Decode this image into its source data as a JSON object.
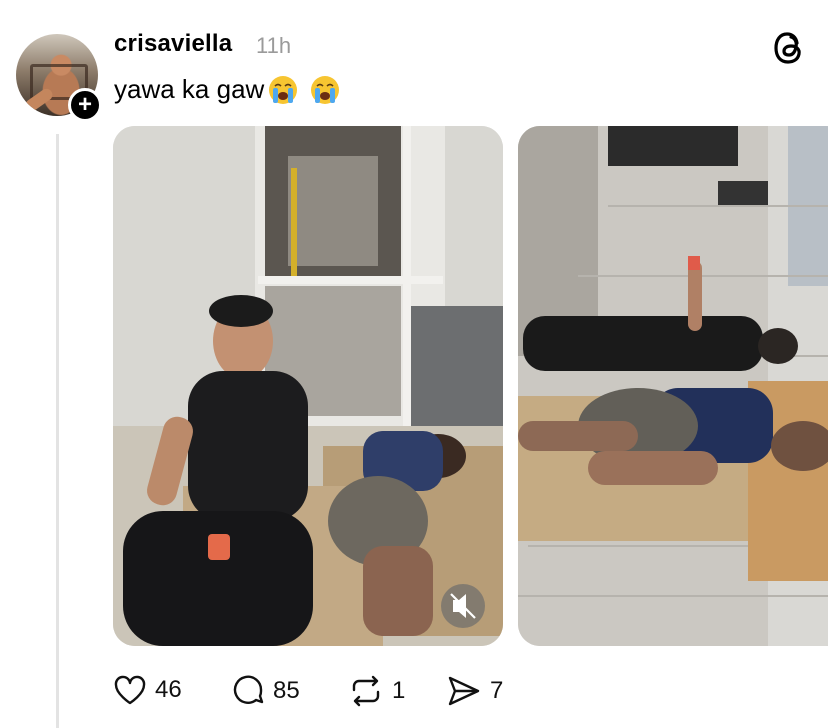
{
  "post": {
    "username": "crisaviella",
    "time": "11h",
    "caption": "yawa ka gaw",
    "caption_emojis": [
      "loudly-crying-face",
      "loudly-crying-face"
    ]
  },
  "actions": {
    "likes": "46",
    "replies": "85",
    "reposts": "1",
    "shares": "7"
  },
  "colors": {
    "text": "#000000",
    "muted": "#9a9a9a",
    "thread_line": "#e3e3e3"
  },
  "icons": [
    "threads-logo-icon",
    "plus-icon",
    "mute-icon",
    "heart-icon",
    "comment-icon",
    "repost-icon",
    "share-icon"
  ]
}
